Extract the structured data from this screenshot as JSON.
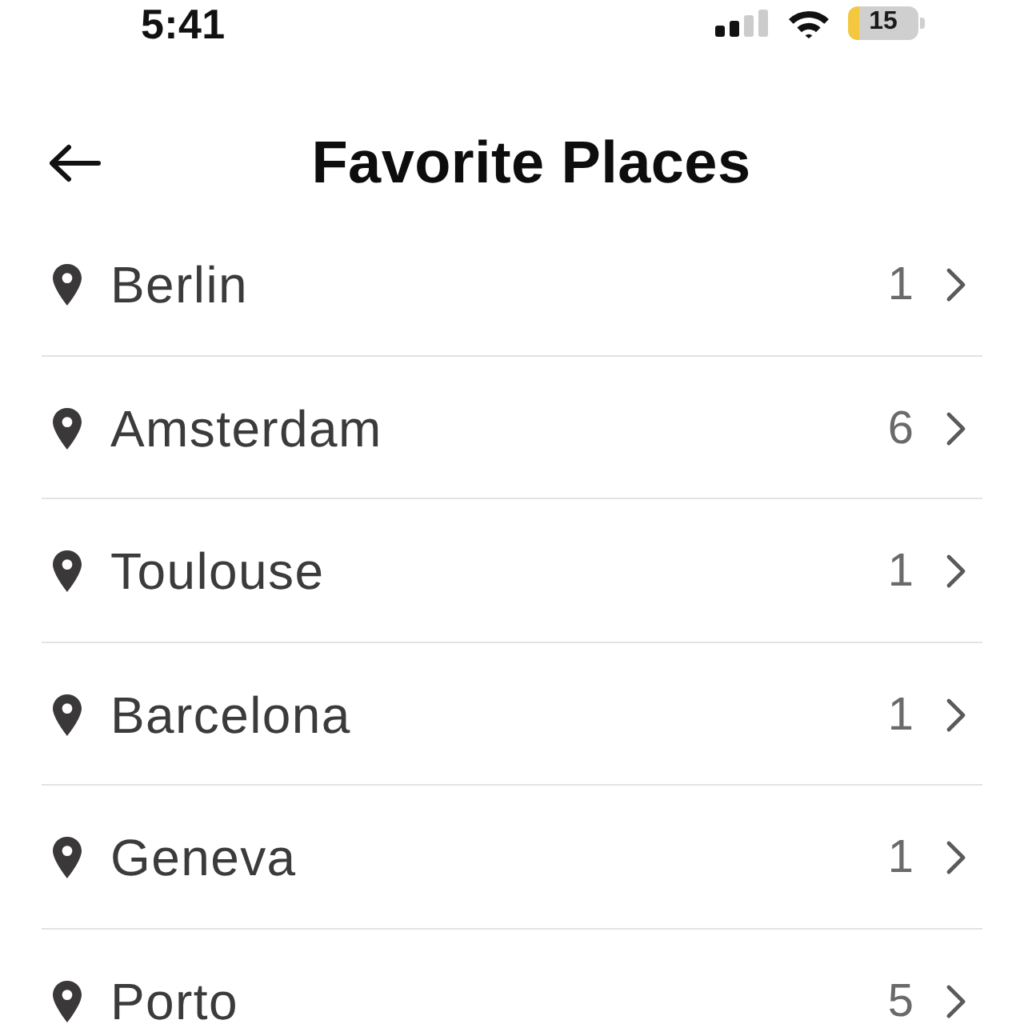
{
  "status_bar": {
    "time": "5:41",
    "battery": "15"
  },
  "header": {
    "title": "Favorite Places"
  },
  "places": [
    {
      "name": "Berlin",
      "count": "1"
    },
    {
      "name": "Amsterdam",
      "count": "6"
    },
    {
      "name": "Toulouse",
      "count": "1"
    },
    {
      "name": "Barcelona",
      "count": "1"
    },
    {
      "name": "Geneva",
      "count": "1"
    },
    {
      "name": "Porto",
      "count": "5"
    }
  ]
}
